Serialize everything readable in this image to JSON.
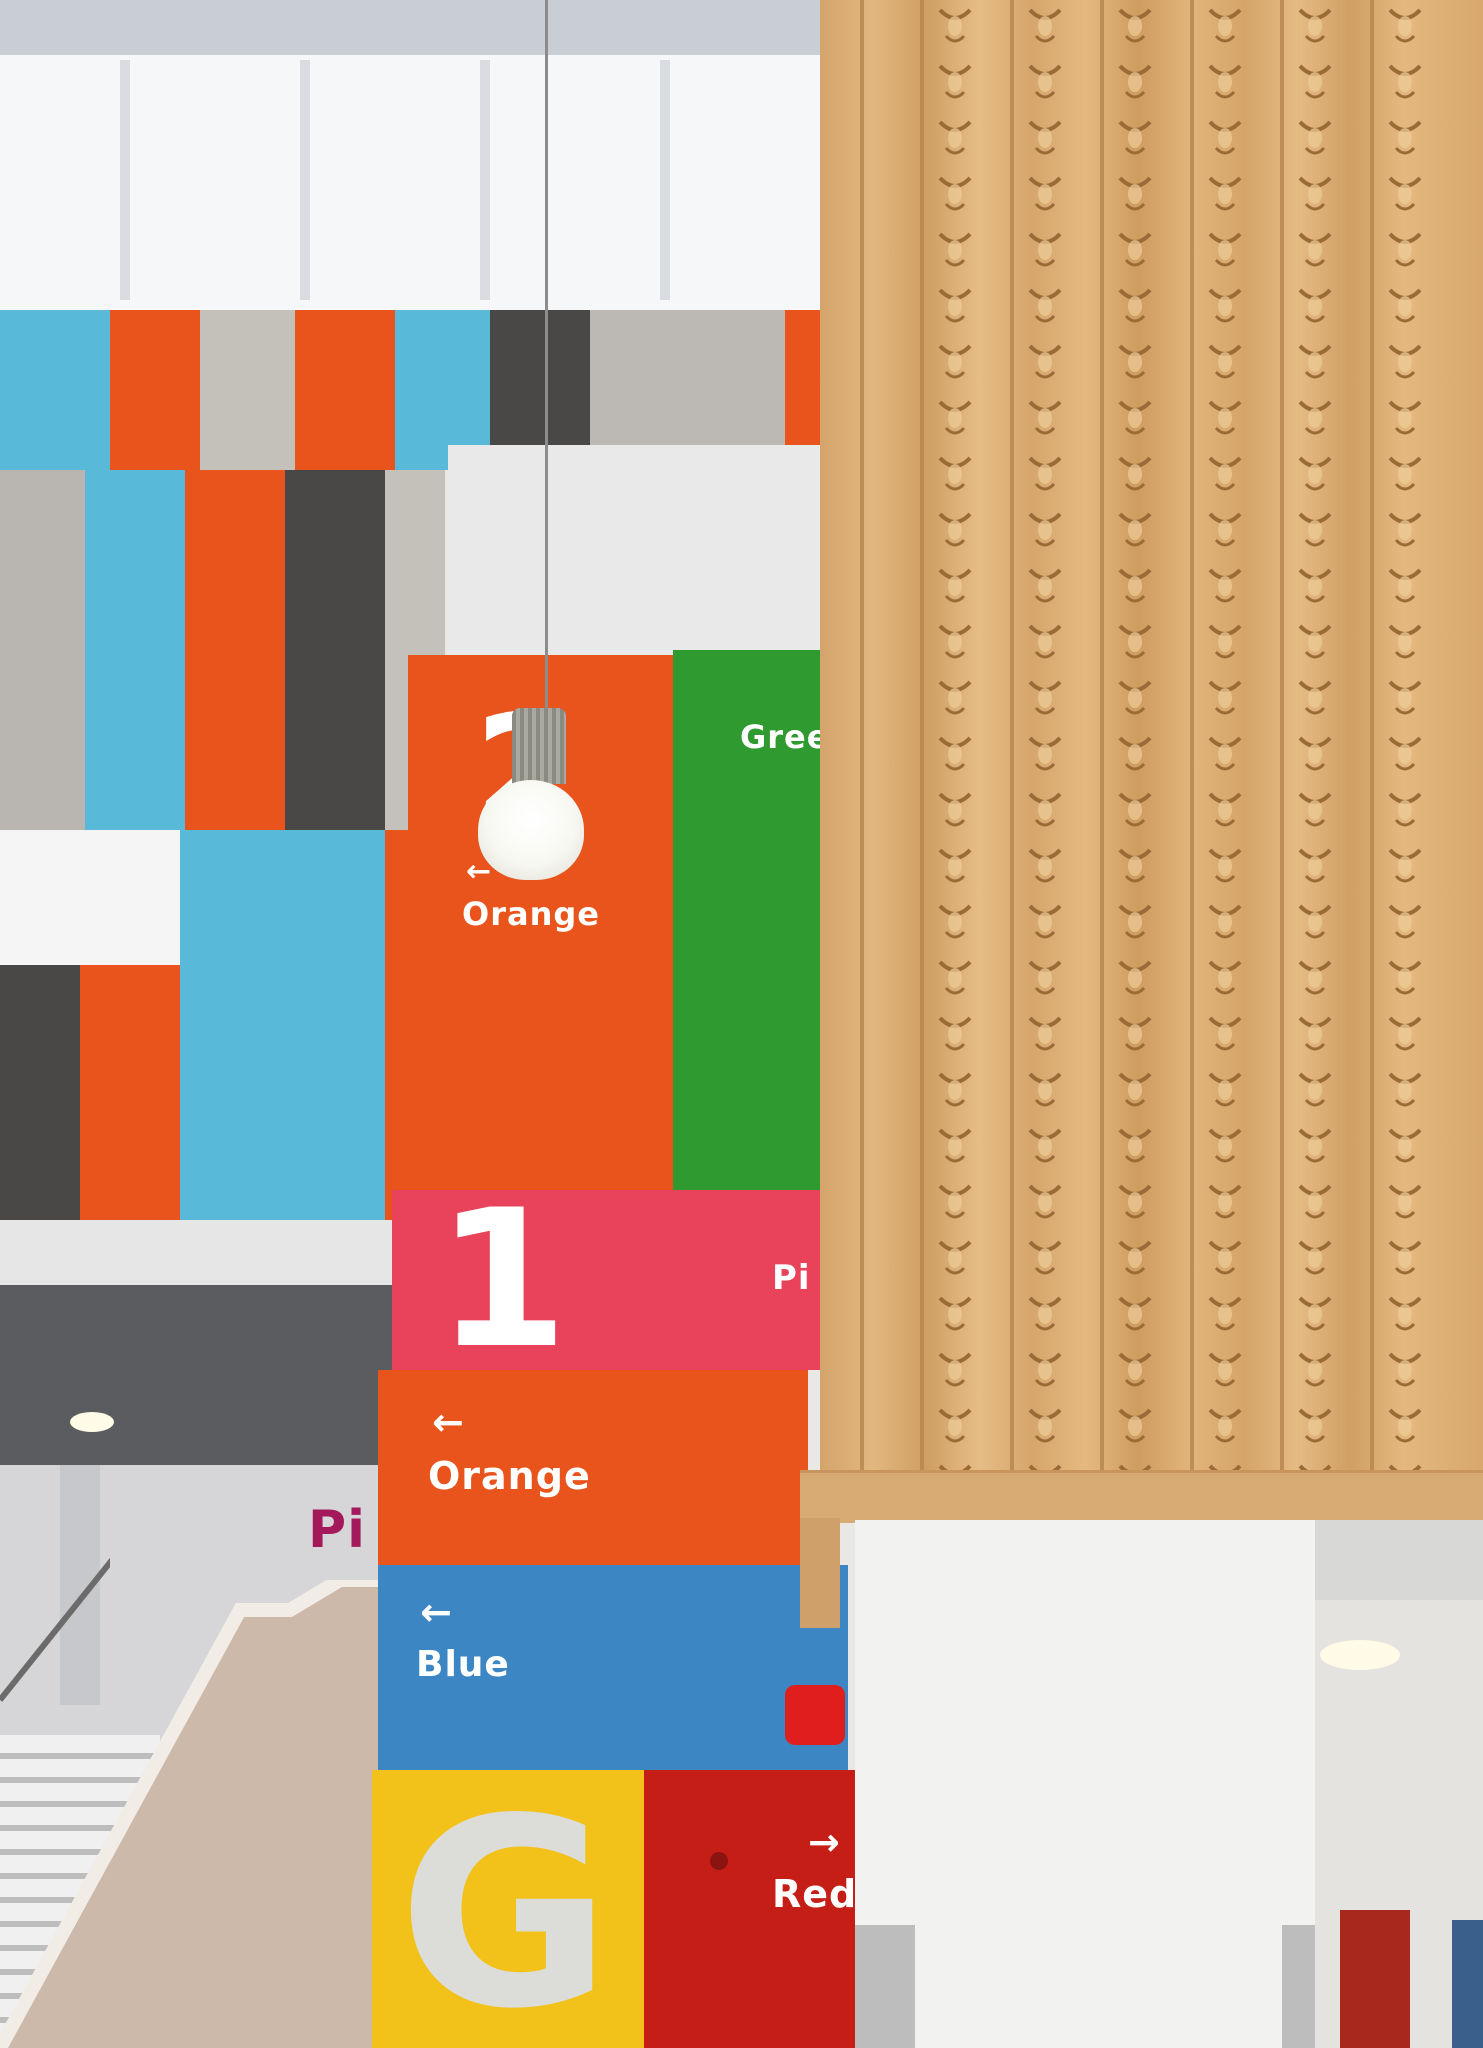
{
  "signage": {
    "floor2_label": "Orange",
    "floor2_green_label": "Gree",
    "floor1_number": "1",
    "floor1_pink_label": "Pi",
    "floor1_orange_label": "Orange",
    "floor1_blue_label": "Blue",
    "ground_letter": "G",
    "ground_red_label": "Red",
    "side_pink_label": "Pi",
    "arrow_left": "←",
    "arrow_right": "→"
  },
  "colors": {
    "orange": "#e8541c",
    "green": "#2f9a2f",
    "pink": "#e8435a",
    "blue": "#3d86c4",
    "yellow": "#f2c21b",
    "red": "#c41e17",
    "light_blue": "#58b9d8",
    "grey": "#b9b5b0",
    "dark_grey": "#4a4846",
    "wood": "#dcae75"
  }
}
